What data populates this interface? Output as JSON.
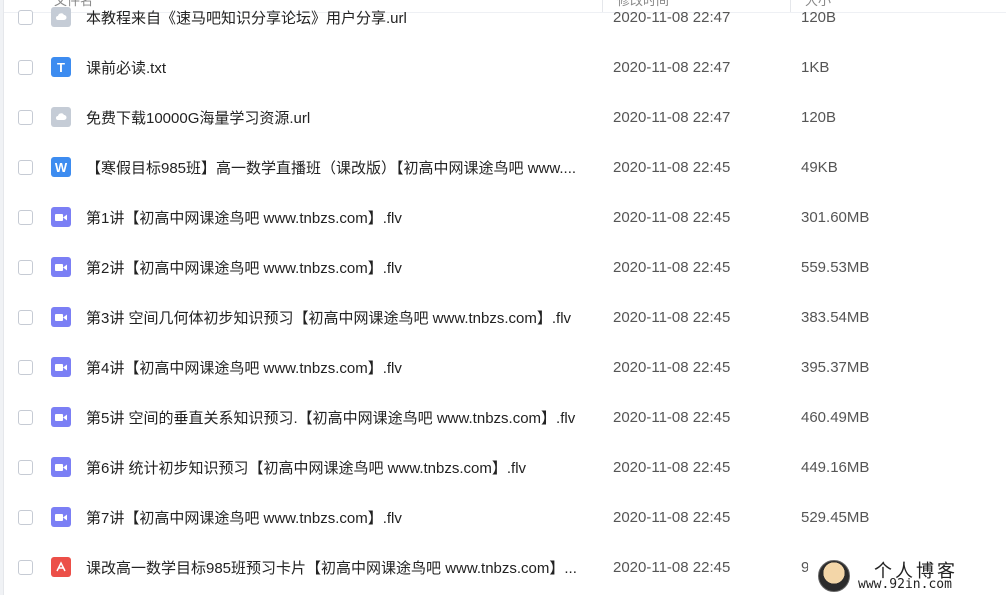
{
  "header": {
    "name_label": "文件名",
    "date_label": "修改时间",
    "size_label": "大小"
  },
  "files": [
    {
      "name": "本教程来自《速马吧知识分享论坛》用户分享.url",
      "date": "2020-11-08 22:47",
      "size": "120B",
      "icon": "url-file-icon"
    },
    {
      "name": "课前必读.txt",
      "date": "2020-11-08 22:47",
      "size": "1KB",
      "icon": "txt-file-icon"
    },
    {
      "name": "免费下载10000G海量学习资源.url",
      "date": "2020-11-08 22:47",
      "size": "120B",
      "icon": "url-file-icon"
    },
    {
      "name": "【寒假目标985班】高一数学直播班（课改版）【初高中网课途鸟吧 www....",
      "date": "2020-11-08 22:45",
      "size": "49KB",
      "icon": "word-file-icon"
    },
    {
      "name": "第1讲【初高中网课途鸟吧 www.tnbzs.com】.flv",
      "date": "2020-11-08 22:45",
      "size": "301.60MB",
      "icon": "video-file-icon"
    },
    {
      "name": "第2讲【初高中网课途鸟吧 www.tnbzs.com】.flv",
      "date": "2020-11-08 22:45",
      "size": "559.53MB",
      "icon": "video-file-icon"
    },
    {
      "name": "第3讲 空间几何体初步知识预习【初高中网课途鸟吧 www.tnbzs.com】.flv",
      "date": "2020-11-08 22:45",
      "size": "383.54MB",
      "icon": "video-file-icon"
    },
    {
      "name": "第4讲【初高中网课途鸟吧 www.tnbzs.com】.flv",
      "date": "2020-11-08 22:45",
      "size": "395.37MB",
      "icon": "video-file-icon"
    },
    {
      "name": "第5讲 空间的垂直关系知识预习.【初高中网课途鸟吧 www.tnbzs.com】.flv",
      "date": "2020-11-08 22:45",
      "size": "460.49MB",
      "icon": "video-file-icon"
    },
    {
      "name": "第6讲 统计初步知识预习【初高中网课途鸟吧 www.tnbzs.com】.flv",
      "date": "2020-11-08 22:45",
      "size": "449.16MB",
      "icon": "video-file-icon"
    },
    {
      "name": "第7讲【初高中网课途鸟吧 www.tnbzs.com】.flv",
      "date": "2020-11-08 22:45",
      "size": "529.45MB",
      "icon": "video-file-icon"
    },
    {
      "name": "课改高一数学目标985班预习卡片【初高中网课途鸟吧 www.tnbzs.com】...",
      "date": "2020-11-08 22:45",
      "size": "9",
      "icon": "pdf-file-icon"
    }
  ],
  "icon_glyphs": {
    "txt": "T",
    "doc": "W"
  },
  "watermark": {
    "title": "个人博客",
    "url": "www.92in.com"
  },
  "colors": {
    "txt": "#3d8cf0",
    "url": "#c5ccd6",
    "video": "#7b7ff5",
    "pdf": "#ec4f48"
  }
}
